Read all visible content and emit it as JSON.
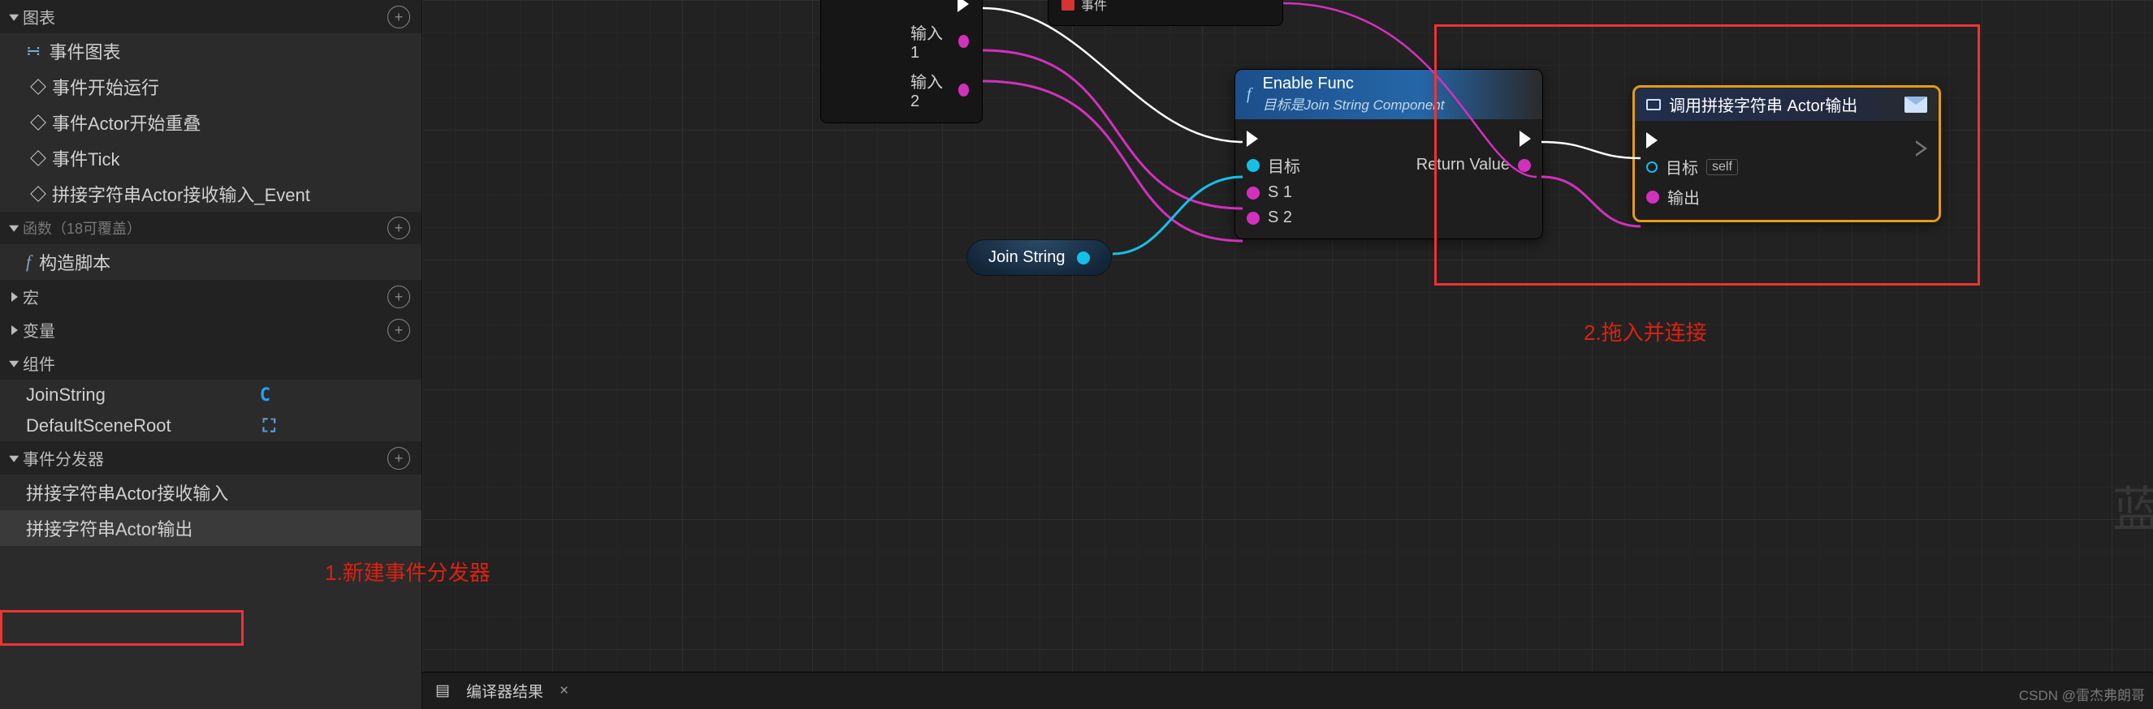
{
  "sidebar": {
    "graphs": {
      "title": "图表",
      "eventGraph": "事件图表",
      "items": [
        "事件开始运行",
        "事件Actor开始重叠",
        "事件Tick",
        "拼接字符串Actor接收输入_Event"
      ]
    },
    "functions": {
      "title": "函数（18可覆盖）",
      "construction": "构造脚本"
    },
    "macros": {
      "title": "宏"
    },
    "variables": {
      "title": "变量"
    },
    "components": {
      "title": "组件",
      "items": [
        "JoinString",
        "DefaultSceneRoot"
      ]
    },
    "dispatchers": {
      "title": "事件分发器",
      "items": [
        "拼接字符串Actor接收输入",
        "拼接字符串Actor输出"
      ]
    }
  },
  "graph": {
    "partial": {
      "eventLabel": "事件"
    },
    "floating": {
      "input1": "输入 1",
      "input2": "输入 2"
    },
    "varCapsule": {
      "label": "Join String"
    },
    "enableFunc": {
      "title": "Enable Func",
      "subtitle": "目标是Join String Component",
      "target": "目标",
      "s1": "S 1",
      "s2": "S 2",
      "returnValue": "Return Value"
    },
    "callDispatcher": {
      "title": "调用拼接字符串 Actor输出",
      "target": "目标",
      "selfLabel": "self",
      "output": "输出"
    }
  },
  "bottomBar": {
    "compilerResults": "编译器结果"
  },
  "annotations": {
    "newDispatcher": "1.新建事件分发器",
    "dragConnect": "2.拖入并连接"
  },
  "watermark": "CSDN @雷杰弗朗哥",
  "bigWatermark": "蓝"
}
